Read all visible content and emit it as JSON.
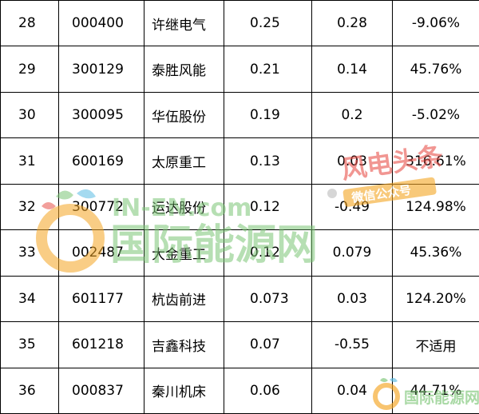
{
  "rows": [
    {
      "rank": "28",
      "code": "000400",
      "name": "许继电气",
      "v1": "0.25",
      "v2": "0.28",
      "change": "-9.06%"
    },
    {
      "rank": "29",
      "code": "300129",
      "name": "泰胜风能",
      "v1": "0.21",
      "v2": "0.14",
      "change": "45.76%"
    },
    {
      "rank": "30",
      "code": "300095",
      "name": "华伍股份",
      "v1": "0.19",
      "v2": "0.2",
      "change": "-5.02%"
    },
    {
      "rank": "31",
      "code": "600169",
      "name": "太原重工",
      "v1": "0.13",
      "v2": "0.03",
      "change": "316.61%"
    },
    {
      "rank": "32",
      "code": "300772",
      "name": "运达股份",
      "v1": "0.12",
      "v2": "-0.49",
      "change": "124.98%"
    },
    {
      "rank": "33",
      "code": "002487",
      "name": "大金重工",
      "v1": "0.12",
      "v2": "0.079",
      "change": "45.36%"
    },
    {
      "rank": "34",
      "code": "601177",
      "name": "杭齿前进",
      "v1": "0.073",
      "v2": "0.03",
      "change": "124.20%"
    },
    {
      "rank": "35",
      "code": "601218",
      "name": "吉鑫科技",
      "v1": "0.07",
      "v2": "-0.55",
      "change": "不适用"
    },
    {
      "rank": "36",
      "code": "000837",
      "name": "秦川机床",
      "v1": "0.06",
      "v2": "0.04",
      "change": "44.71%"
    }
  ],
  "watermarks": {
    "main_url": "IN-EN.com",
    "main_cn": "国际能源网",
    "second_cn": "风电头条",
    "second_sub": "微信公众号",
    "corner_cn": "国际能源网"
  },
  "colors": {
    "green": "#7cc576",
    "orange": "#f5a623",
    "red": "#e8514a",
    "blue": "#5bbde4"
  }
}
